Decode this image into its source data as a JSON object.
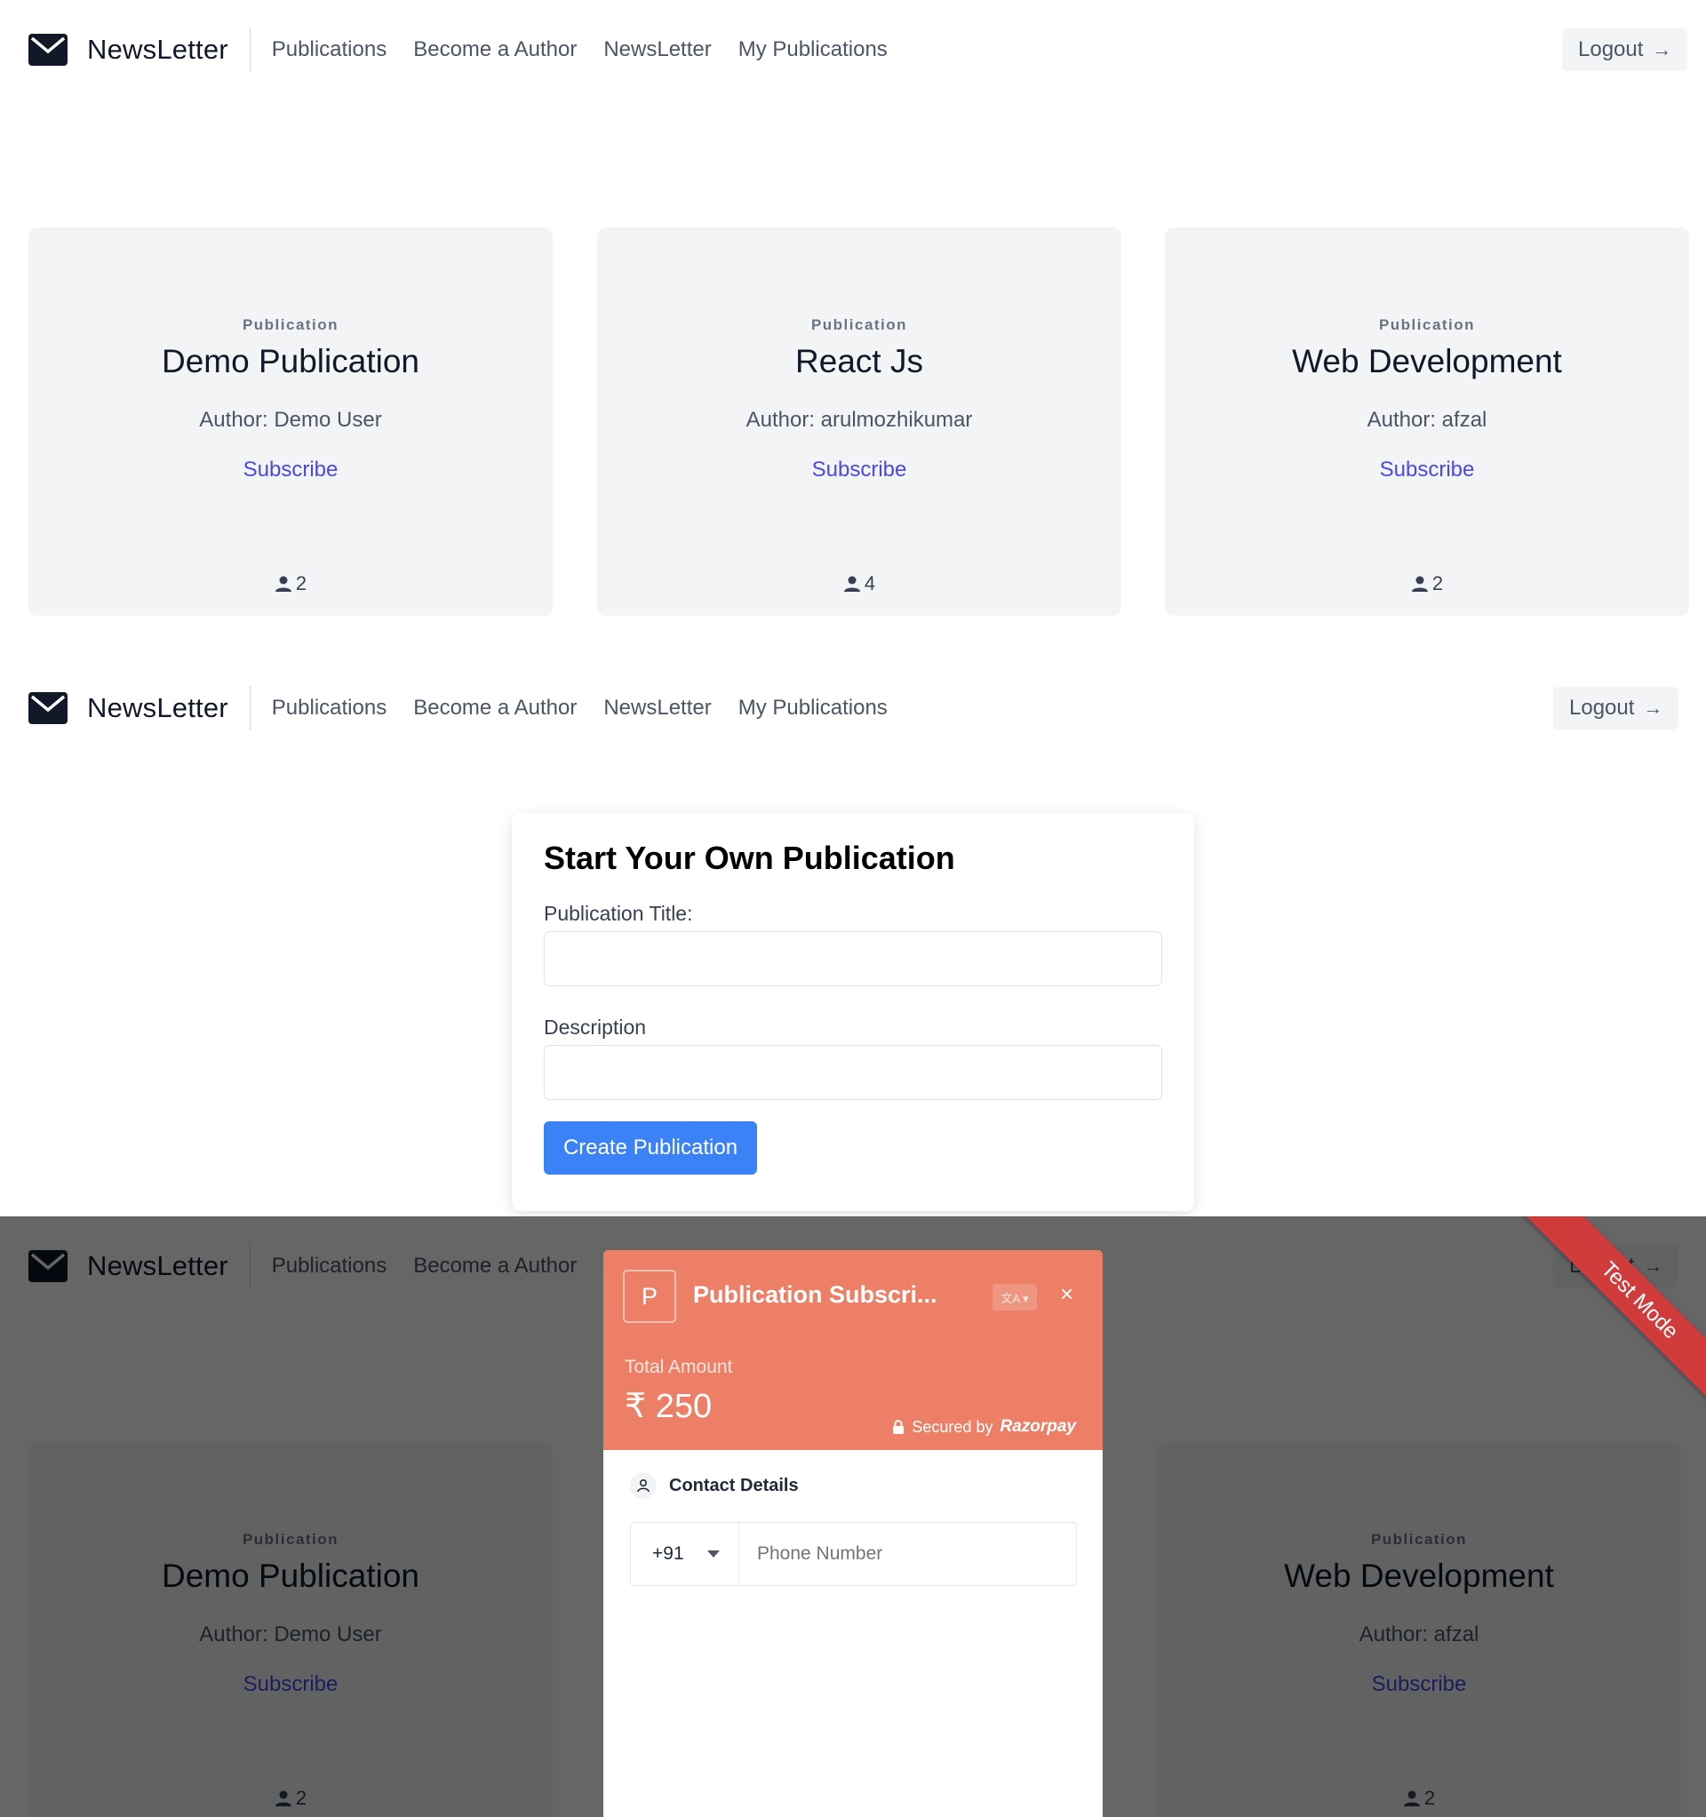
{
  "nav": {
    "brand": "NewsLetter",
    "links": [
      "Publications",
      "Become a Author",
      "NewsLetter",
      "My Publications"
    ],
    "logout": "Logout",
    "logout_arrow": "→"
  },
  "cards": [
    {
      "label": "Publication",
      "title": "Demo Publication",
      "author": "Author: Demo User",
      "subscribe": "Subscribe",
      "count": "2"
    },
    {
      "label": "Publication",
      "title": "React Js",
      "author": "Author: arulmozhikumar",
      "subscribe": "Subscribe",
      "count": "4"
    },
    {
      "label": "Publication",
      "title": "Web Development",
      "author": "Author: afzal",
      "subscribe": "Subscribe",
      "count": "2"
    }
  ],
  "form": {
    "title": "Start Your Own Publication",
    "title_label": "Publication Title:",
    "title_value": "",
    "description_label": "Description",
    "description_value": "",
    "submit": "Create Publication"
  },
  "modal": {
    "logo_letter": "P",
    "title": "Publication Subscri...",
    "close": "×",
    "total_label": "Total Amount",
    "amount": "₹ 250",
    "secured_by": "Secured by",
    "provider": "Razorpay",
    "contact_heading": "Contact Details",
    "country_code": "+91",
    "phone_placeholder": "Phone Number",
    "ribbon": "Test Mode"
  },
  "colors": {
    "accent": "#3b82f6",
    "link": "#4f46e5",
    "modal_header": "#ec7f66",
    "ribbon": "#d03b3b"
  }
}
